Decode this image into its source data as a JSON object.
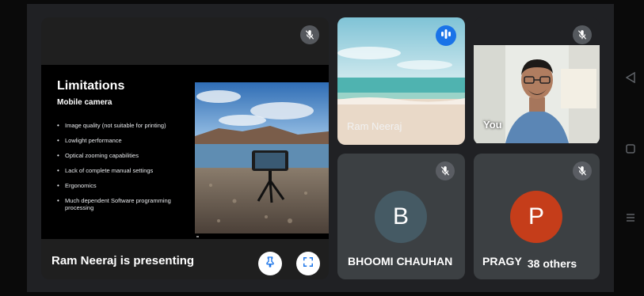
{
  "presentation": {
    "presenting_label": "Ram Neeraj is presenting",
    "slide": {
      "title": "Limitations",
      "subtitle": "Mobile camera",
      "bullets": [
        "Image quality (not suitable for printing)",
        "Lowlight performance",
        "Optical zooming capabilities",
        "Lack of complete manual settings",
        "Ergonomics",
        "Much dependent Software programming processing"
      ]
    }
  },
  "participants": [
    {
      "name": "Ram Neeraj",
      "state": "speaking"
    },
    {
      "name": "You",
      "state": "muted"
    },
    {
      "name": "BHOOMI CHAUHAN",
      "initial": "B",
      "avatar_color": "#455a64",
      "state": "muted"
    },
    {
      "name": "PRAGYA",
      "initial": "P",
      "avatar_color": "#c53d1a",
      "state": "muted"
    }
  ],
  "others_label": "38 others",
  "icons": {
    "mute": "mic-off-icon",
    "speaking": "audio-level-icon",
    "pin": "pin-icon",
    "fullscreen": "fullscreen-icon"
  },
  "colors": {
    "background": "#202124",
    "tile": "#3c4043",
    "accent_blue": "#1a73e8"
  }
}
